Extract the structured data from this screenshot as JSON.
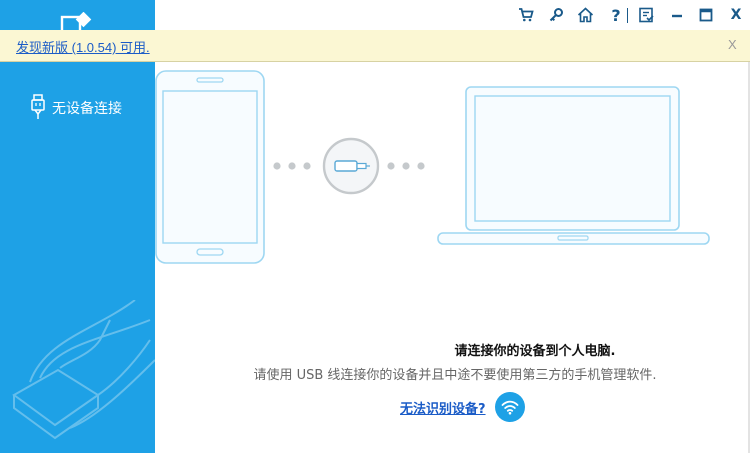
{
  "sidebar": {
    "logo_icon": "app-logo-icon",
    "device_icon": "usb-cable-icon",
    "device_status": "无设备连接",
    "illustration_icon": "hand-phone-illustration"
  },
  "titlebar": {
    "buttons": [
      {
        "icon": "cart-icon"
      },
      {
        "icon": "key-icon"
      },
      {
        "icon": "home-icon"
      },
      {
        "icon": "help-icon",
        "label": "?"
      },
      {
        "icon": "feedback-icon"
      },
      {
        "icon": "minimize-icon"
      },
      {
        "icon": "maximize-icon"
      },
      {
        "icon": "close-icon",
        "label": "X"
      }
    ]
  },
  "notice": {
    "text": "发现新版 (1.0.54) 可用.",
    "close_label": "X"
  },
  "illustration": {
    "phone_icon": "phone-outline-icon",
    "connector_icon": "usb-plug-icon",
    "laptop_icon": "laptop-outline-icon"
  },
  "message": {
    "title": "请连接你的设备到个人电脑.",
    "subtitle": "请使用 USB 线连接你的设备并且中途不要使用第三方的手机管理软件.",
    "help_link": "无法识别设备?",
    "help_icon": "wifi-icon"
  },
  "colors": {
    "sidebar": "#1ea1e6",
    "notice_bg": "#fbf7d3",
    "link": "#1b5cc7",
    "outline": "#7fcdf0"
  }
}
